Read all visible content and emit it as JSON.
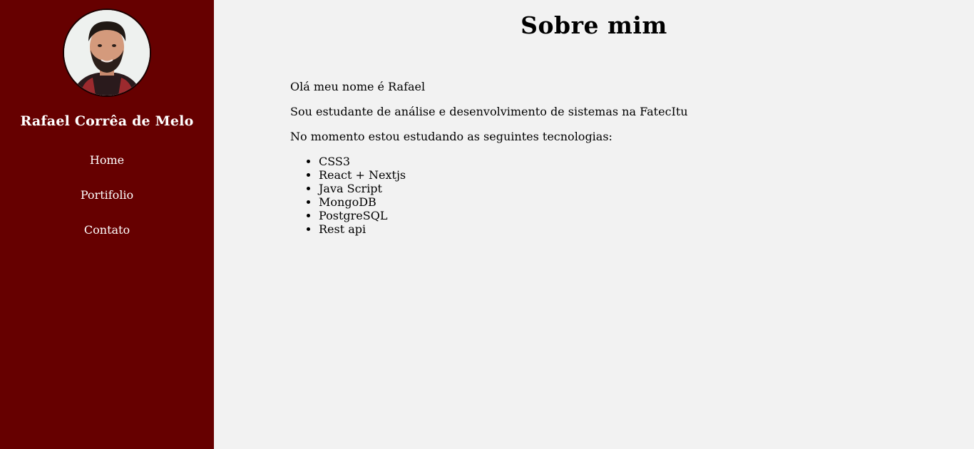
{
  "sidebar": {
    "avatar_alt": "Foto de perfil",
    "name": "Rafael Corrêa de Melo",
    "nav": [
      {
        "label": "Home"
      },
      {
        "label": "Portifolio"
      },
      {
        "label": "Contato"
      }
    ]
  },
  "main": {
    "title": "Sobre mim",
    "paragraphs": [
      "Olá meu nome é Rafael",
      "Sou estudante de análise e desenvolvimento de sistemas na FatecItu",
      "No momento estou estudando as seguintes tecnologias:"
    ],
    "technologies": [
      "CSS3",
      "React + Nextjs",
      "Java Script",
      "MongoDB",
      "PostgreSQL",
      "Rest api"
    ]
  },
  "colors": {
    "sidebar_bg": "#660000",
    "main_bg": "#f2f2f2",
    "sidebar_text": "#ffffff",
    "main_text": "#000000"
  }
}
